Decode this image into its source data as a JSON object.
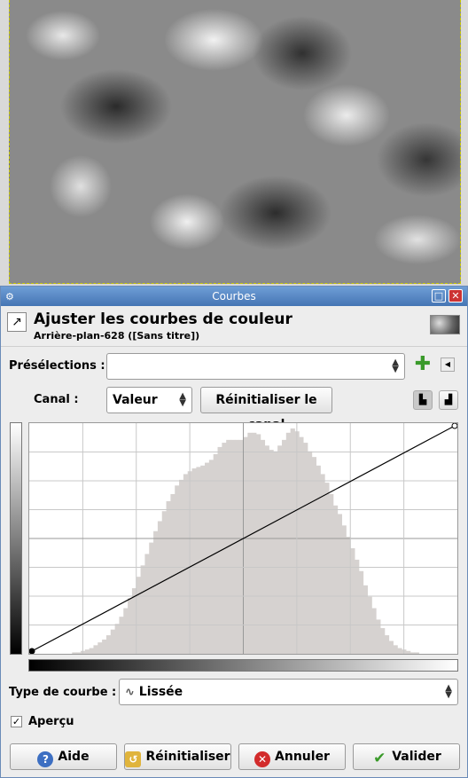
{
  "window": {
    "title": "Courbes",
    "maximize": "□",
    "close": "✕"
  },
  "header": {
    "title": "Ajuster les courbes de couleur",
    "subtitle": "Arrière-plan-628 ([Sans titre])"
  },
  "presets": {
    "label": "Présélections :",
    "value": ""
  },
  "channel": {
    "label": "Canal :",
    "value": "Valeur",
    "reset_label": "Réinitialiser le canal"
  },
  "curve_type": {
    "label": "Type de courbe :",
    "value": "Lissée"
  },
  "preview": {
    "label": "Aperçu",
    "checked": true
  },
  "buttons": {
    "help": "Aide",
    "reset": "Réinitialiser",
    "cancel": "Annuler",
    "ok": "Valider"
  },
  "icons": {
    "help": "help-icon",
    "reset": "reset-icon",
    "cancel": "cancel-icon",
    "ok": "ok-icon",
    "add_preset": "add-icon",
    "preset_menu": "menu-arrow-icon",
    "linear_hist": "linear-histogram-icon",
    "log_hist": "log-histogram-icon"
  },
  "colors": {
    "accent": "#4575b4",
    "histogram": "#d6d2d0",
    "ok_check": "#3a9a2a",
    "cancel_red": "#d22b2b",
    "help_blue": "#3d6fc2"
  },
  "histogram": {
    "description_bins": [
      0,
      0,
      0,
      0,
      0,
      0,
      0,
      0,
      0,
      0,
      1,
      1,
      2,
      3,
      4,
      6,
      8,
      10,
      13,
      17,
      21,
      26,
      32,
      39,
      46,
      54,
      62,
      70,
      78,
      86,
      93,
      100,
      107,
      112,
      118,
      122,
      126,
      128,
      130,
      131,
      132,
      134,
      136,
      140,
      145,
      148,
      150,
      150,
      150,
      150,
      152,
      155,
      155,
      154,
      150,
      146,
      143,
      142,
      146,
      150,
      155,
      158,
      156,
      152,
      148,
      142,
      138,
      132,
      126,
      120,
      112,
      104,
      98,
      90,
      82,
      74,
      66,
      58,
      48,
      40,
      32,
      24,
      18,
      13,
      9,
      6,
      4,
      3,
      2,
      1,
      1,
      0,
      0,
      0,
      0,
      0,
      0,
      0,
      0,
      0
    ]
  },
  "curve": {
    "points": [
      [
        0,
        0
      ],
      [
        255,
        255
      ]
    ]
  }
}
